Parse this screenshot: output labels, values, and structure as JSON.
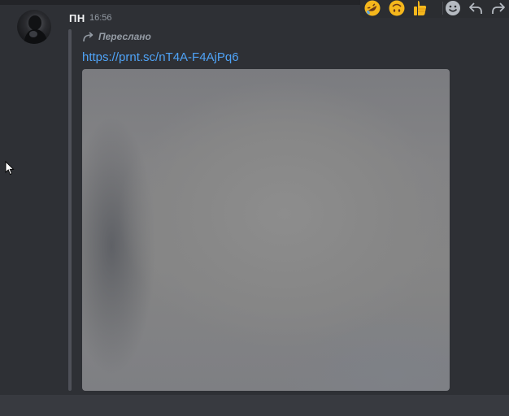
{
  "message": {
    "author": "ПН",
    "timestamp": "16:56",
    "forwarded_label": "Переслано",
    "link_text": "https://prnt.sc/nT4A-F4AjPq6"
  },
  "toolbar": {
    "reactions": [
      "rofl-emoji-icon",
      "upside-down-face-emoji-icon",
      "thumbs-up-emoji-icon"
    ],
    "actions": [
      "add-reaction-icon",
      "reply-icon",
      "forward-icon"
    ]
  },
  "colors": {
    "background": "#2e3035",
    "link": "#4fa3f7",
    "username": "#f2f3f5",
    "muted": "#949ba4"
  }
}
